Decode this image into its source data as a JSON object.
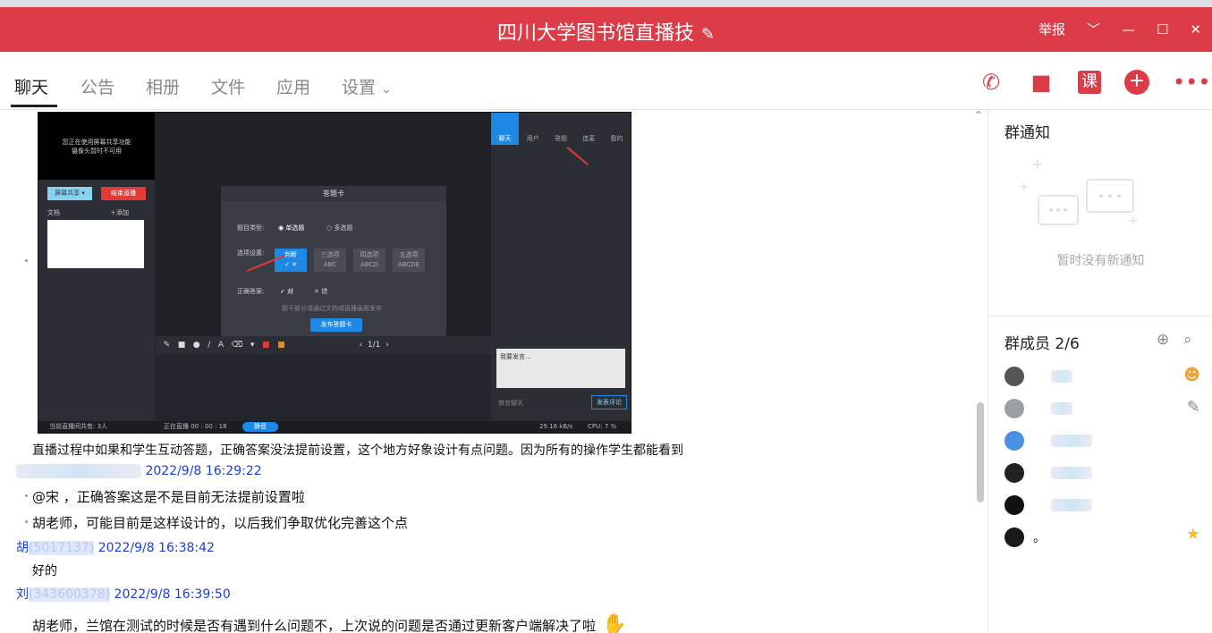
{
  "window": {
    "title": "四川大学图书馆直播技",
    "report": "举报",
    "controls": [
      "﹀",
      "—",
      "☐",
      "✕"
    ]
  },
  "tabs": [
    {
      "label": "聊天",
      "active": true
    },
    {
      "label": "公告"
    },
    {
      "label": "相册"
    },
    {
      "label": "文件"
    },
    {
      "label": "应用"
    },
    {
      "label": "设置"
    }
  ],
  "toolbar": {
    "course_label": "课"
  },
  "screenshot": {
    "preview_text1": "您正在使用屏幕共享功能",
    "preview_text2": "摄像头暂时不可用",
    "share_btn": "屏幕共享 ▾",
    "end_btn": "结束直播",
    "doc_label": "文档",
    "add_label": "＋添加",
    "dialog_title": "答题卡",
    "type_label": "题目类型:",
    "single": "单选题",
    "multi": "多选题",
    "options_label": "选项设置:",
    "opt1": "判断",
    "opt2": "三选项",
    "opt2_sub": "ABC",
    "opt3": "四选项",
    "opt3_sub": "ABCD",
    "opt4": "五选项",
    "opt4_sub": "ABCDE",
    "answer_label": "正确答案:",
    "right": "对",
    "wrong": "错",
    "hint": "题干部分请通过文档或直播画面发布",
    "publish": "发布答题卡",
    "right_tabs": [
      "聊天",
      "用户",
      "答题",
      "连麦",
      "我的"
    ],
    "input_placeholder": "我要发言...",
    "forbid": "禁言聊天",
    "send": "发表评论",
    "status_left": "当前直播间共有: 3人",
    "status_mid": "正在直播 00 : 00 : 18",
    "mute": "静音",
    "speed": "29.16 kB/s",
    "cpu": "CPU:  7 %",
    "page_num": "1/1"
  },
  "messages": [
    {
      "text": "直播过程中如果和学生互动答题，正确答案没法提前设置，这个地方好象设计有点问题。因为所有的操作学生都能看到"
    },
    {
      "meta_time": "2022/9/8 16:29:22"
    },
    {
      "text": "@宋   ，正确答案这是不是目前无法提前设置啦"
    },
    {
      "text": "胡老师，可能目前是这样设计的，以后我们争取优化完善这个点"
    },
    {
      "meta_name": "胡",
      "meta_id": "(5017137)",
      "meta_time": "2022/9/8 16:38:42"
    },
    {
      "text": "好的"
    },
    {
      "meta_name": "刘",
      "meta_id": "(343600378)",
      "meta_time": "2022/9/8 16:39:50"
    },
    {
      "text": "胡老师，兰馆在测试的时候是否有遇到什么问题不，上次说的问题是否通过更新客户端解决了啦"
    }
  ],
  "sidebar": {
    "notice_title": "群通知",
    "notice_empty": "暂时没有新通知",
    "members_title": "群成员 2/6",
    "members": [
      {
        "name": "",
        "avatar": "#555555",
        "badge": "person-icon"
      },
      {
        "name": "",
        "avatar": "#9aa0a8",
        "badge": "edit-icon"
      },
      {
        "name": "",
        "avatar": "#4a90e2",
        "badge": ""
      },
      {
        "name": "",
        "avatar": "#222222",
        "badge": ""
      },
      {
        "name": "",
        "avatar": "#111111",
        "badge": ""
      },
      {
        "name": "。",
        "avatar": "#1a1a1a",
        "badge": "star-icon"
      }
    ]
  },
  "colors": {
    "brand": "#dc3c47",
    "link": "#1a3fd6"
  }
}
